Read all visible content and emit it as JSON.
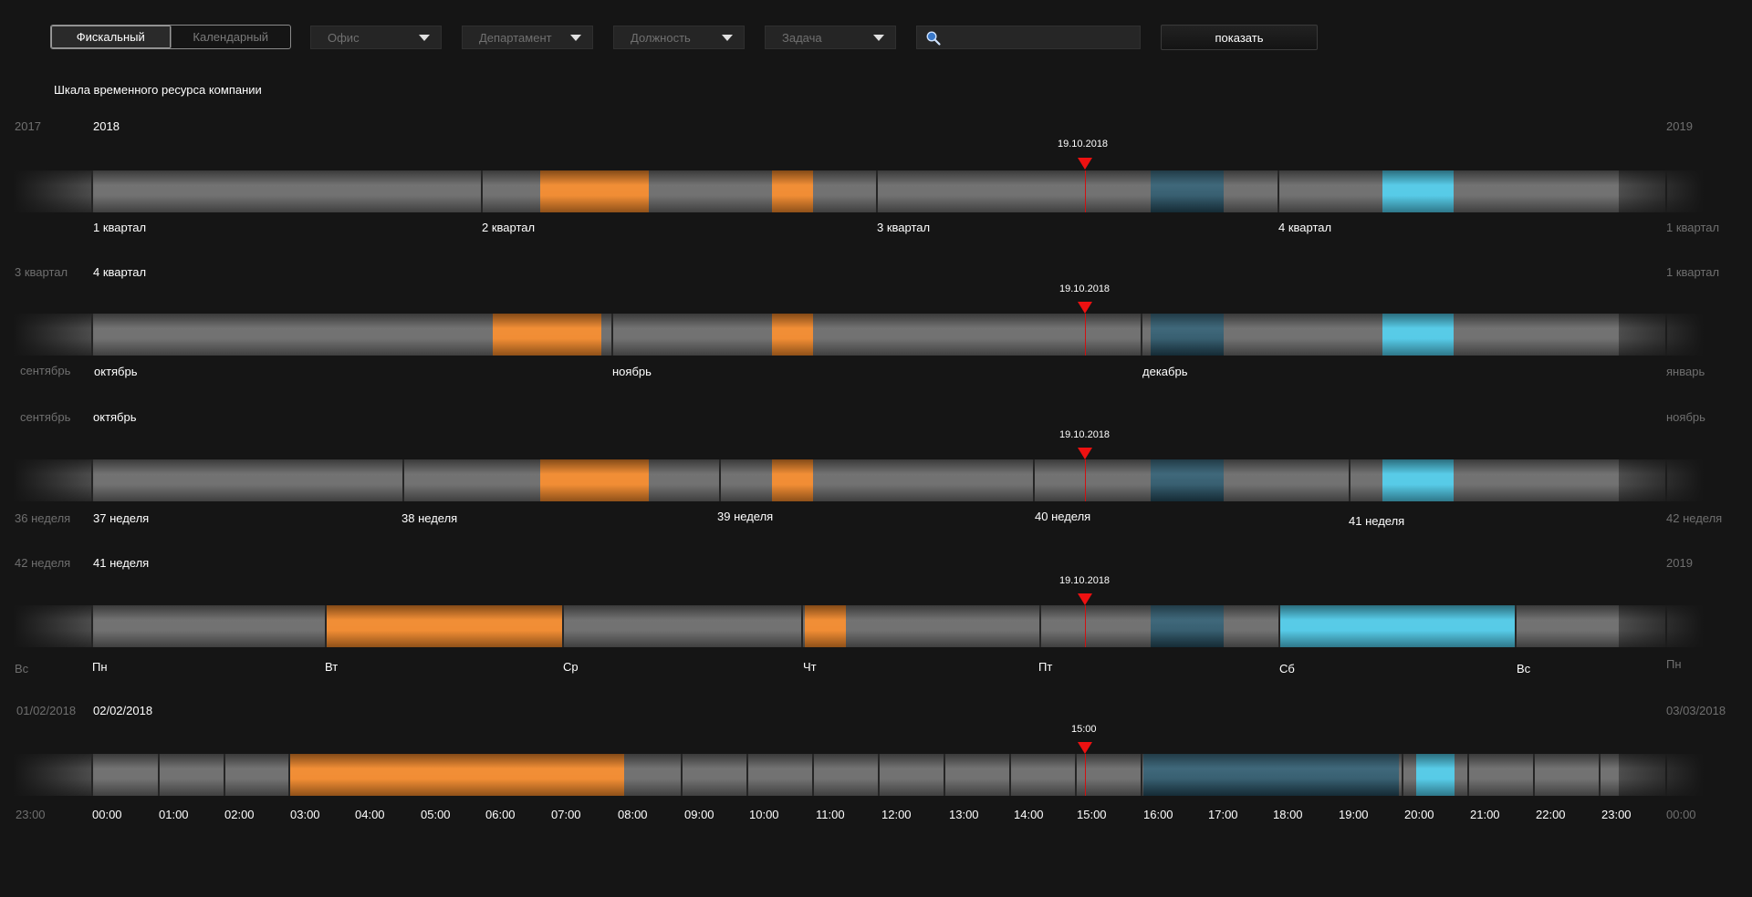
{
  "toolbar": {
    "seg_fiscal": "Фискальный",
    "seg_calendar": "Календарный",
    "office": "Офис",
    "department": "Департамент",
    "position": "Должность",
    "task": "Задача",
    "search_value": "",
    "show": "показать"
  },
  "page_title": "Шкала временного ресурса компании",
  "colors": {
    "orange": "#f0872a",
    "dark_teal": "#2f5c70",
    "cyan": "#4ec8e6",
    "now_marker": "#ee1111",
    "track": "#6a6a6a"
  },
  "rows": [
    {
      "prev_header": "2017",
      "cur_header": "2018",
      "next_header": "2019",
      "now_label": "19.10.2018",
      "prev_bottom": "",
      "next_bottom": "1 квартал",
      "ticks": [
        "1 квартал",
        "2 квартал",
        "3 квартал",
        "4 квартал"
      ]
    },
    {
      "prev_header": "3 квартал",
      "cur_header": "4 квартал",
      "next_header": "1 квартал",
      "now_label": "19.10.2018",
      "prev_bottom": "сентябрь",
      "next_bottom": "январь",
      "ticks": [
        "октябрь",
        "ноябрь",
        "декабрь"
      ]
    },
    {
      "prev_header": "сентябрь",
      "cur_header": "октябрь",
      "next_header": "ноябрь",
      "now_label": "19.10.2018",
      "prev_bottom": "36 неделя",
      "next_bottom": "42 неделя",
      "ticks": [
        "37 неделя",
        "38 неделя",
        "39 неделя",
        "40 неделя",
        "41 неделя"
      ]
    },
    {
      "prev_header": "42 неделя",
      "cur_header": "41 неделя",
      "next_header": "2019",
      "now_label": "19.10.2018",
      "prev_bottom": "Вс",
      "next_bottom": "Пн",
      "ticks": [
        "Пн",
        "Вт",
        "Ср",
        "Чт",
        "Пт",
        "Сб",
        "Вс"
      ]
    },
    {
      "prev_header": "01/02/2018",
      "cur_header": "02/02/2018",
      "next_header": "03/03/2018",
      "now_label": "15:00",
      "prev_bottom": "23:00",
      "next_bottom": "00:00",
      "ticks": [
        "00:00",
        "01:00",
        "02:00",
        "03:00",
        "04:00",
        "05:00",
        "06:00",
        "07:00",
        "08:00",
        "09:00",
        "10:00",
        "11:00",
        "12:00",
        "13:00",
        "14:00",
        "15:00",
        "16:00",
        "17:00",
        "18:00",
        "19:00",
        "20:00",
        "21:00",
        "22:00",
        "23:00"
      ]
    }
  ]
}
